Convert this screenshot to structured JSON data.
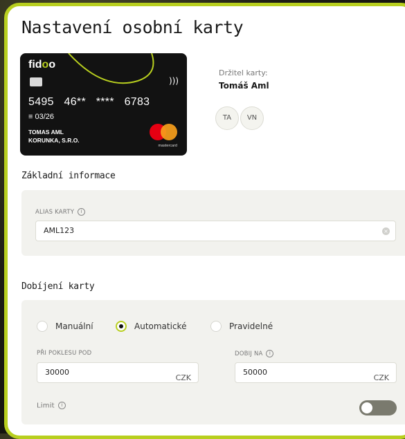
{
  "page": {
    "title": "Nastavení osobní karty"
  },
  "card": {
    "brand_prefix": "fid",
    "brand_dot": "o",
    "brand_suffix": "o",
    "number": "5495 46** **** 6783",
    "expiry": "03/26",
    "holder_line1": "TOMAS AML",
    "holder_line2": "KORUNKA, S.R.O.",
    "network_label": "mastercard"
  },
  "holder": {
    "label": "Držitel karty:",
    "name": "Tomáš Aml",
    "avatars": [
      "TA",
      "VN"
    ]
  },
  "basic_info": {
    "title": "Základní informace",
    "alias_label": "ALIAS KARTY",
    "alias_value": "AML123"
  },
  "topup": {
    "title": "Dobíjení karty",
    "options": [
      "Manuální",
      "Automatické",
      "Pravidelné"
    ],
    "selected": "Automatické",
    "threshold_label": "PŘI POKLESU POD",
    "threshold_value": "30000",
    "threshold_currency": "CZK",
    "topup_label": "DOBIJ NA",
    "topup_value": "50000",
    "topup_currency": "CZK",
    "limit_label": "Limit",
    "limit_enabled": false
  },
  "colors": {
    "accent": "#b8cf1f",
    "toggle_off": "#7a7a6e"
  }
}
